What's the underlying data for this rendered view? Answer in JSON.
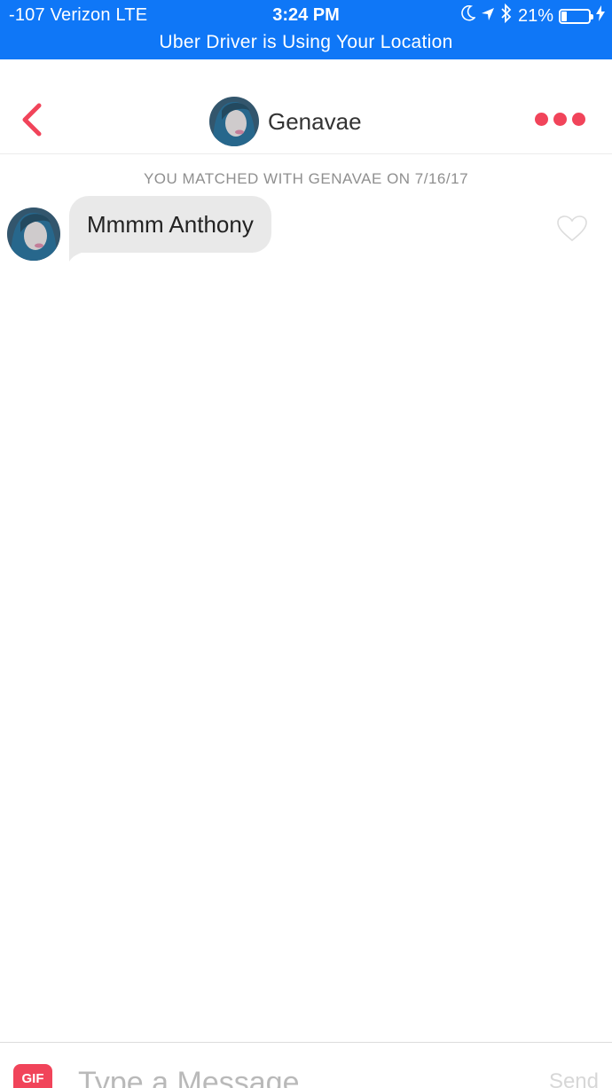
{
  "status_bar": {
    "carrier": "-107 Verizon  LTE",
    "time": "3:24 PM",
    "battery_percent": "21%",
    "battery_level": 0.21,
    "banner": "Uber Driver is Using Your Location",
    "icons": [
      "moon-icon",
      "location-arrow-icon",
      "bluetooth-icon",
      "battery-icon",
      "charging-bolt-icon"
    ],
    "background_color": "#0f77f7"
  },
  "header": {
    "back_icon": "chevron-left-icon",
    "contact_name": "Genavae",
    "more_icon": "more-dots-icon",
    "accent_color": "#f1445a"
  },
  "chat": {
    "match_note": "YOU MATCHED WITH GENAVAE ON 7/16/17",
    "messages": [
      {
        "from": "Genavae",
        "text": "Mmmm Anthony",
        "liked": false
      }
    ]
  },
  "composer": {
    "gif_label": "GIF",
    "placeholder": "Type a Message...",
    "value": "",
    "send_label": "Send"
  }
}
